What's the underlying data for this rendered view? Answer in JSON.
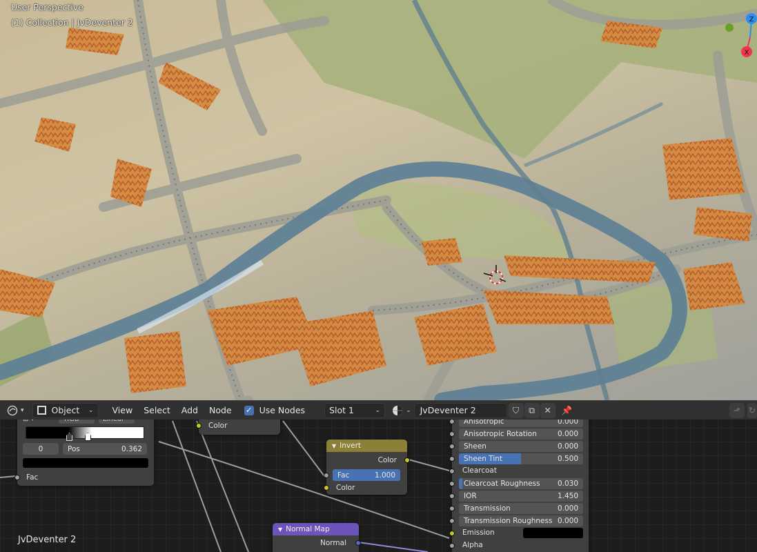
{
  "viewport": {
    "perspective_label": "User Perspective",
    "collection_label": "(1) Collection | JvDeventer 2",
    "gizmo": {
      "z_label": "Z",
      "x_label": "X",
      "colors": {
        "z": "#2a8ff0",
        "x": "#f0364f",
        "y": "#6aa02a"
      }
    }
  },
  "node_editor": {
    "header": {
      "editor_type_icon": "node-editor-icon",
      "mode_label": "Object",
      "menus": [
        "View",
        "Select",
        "Add",
        "Node"
      ],
      "use_nodes_label": "Use Nodes",
      "use_nodes_checked": true,
      "slot_label": "Slot 1",
      "material_name": "JvDeventer 2"
    },
    "colorramp": {
      "mode": "RGB",
      "interpolation": "Linear",
      "index": "0",
      "pos_label": "Pos",
      "pos_value": "0.362",
      "fac_label": "Fac"
    },
    "partial_node": {
      "output_label": "Color"
    },
    "invert": {
      "title": "Invert",
      "output_label": "Color",
      "fac_label": "Fac",
      "fac_value": "1.000",
      "color_label": "Color",
      "header_color": "#8b8036"
    },
    "normal_map": {
      "title": "Normal Map",
      "output_label": "Normal",
      "header_color": "#6d54b8"
    },
    "bsdf_inputs": [
      {
        "label": "Anisotropic",
        "value": "0.000",
        "kind": "field"
      },
      {
        "label": "Anisotropic Rotation",
        "value": "0.000",
        "kind": "field"
      },
      {
        "label": "Sheen",
        "value": "0.000",
        "kind": "field"
      },
      {
        "label": "Sheen Tint",
        "value": "0.500",
        "kind": "field",
        "fill": 0.5
      },
      {
        "label": "Clearcoat",
        "value": "",
        "kind": "label"
      },
      {
        "label": "Clearcoat Roughness",
        "value": "0.030",
        "kind": "field",
        "fill": 0.03
      },
      {
        "label": "IOR",
        "value": "1.450",
        "kind": "field"
      },
      {
        "label": "Transmission",
        "value": "0.000",
        "kind": "field"
      },
      {
        "label": "Transmission Roughness",
        "value": "0.000",
        "kind": "field"
      },
      {
        "label": "Emission",
        "value": "",
        "kind": "color",
        "color": "#000000"
      },
      {
        "label": "Alpha",
        "value": "",
        "kind": "label"
      }
    ],
    "material_label": "JvDeventer 2"
  }
}
